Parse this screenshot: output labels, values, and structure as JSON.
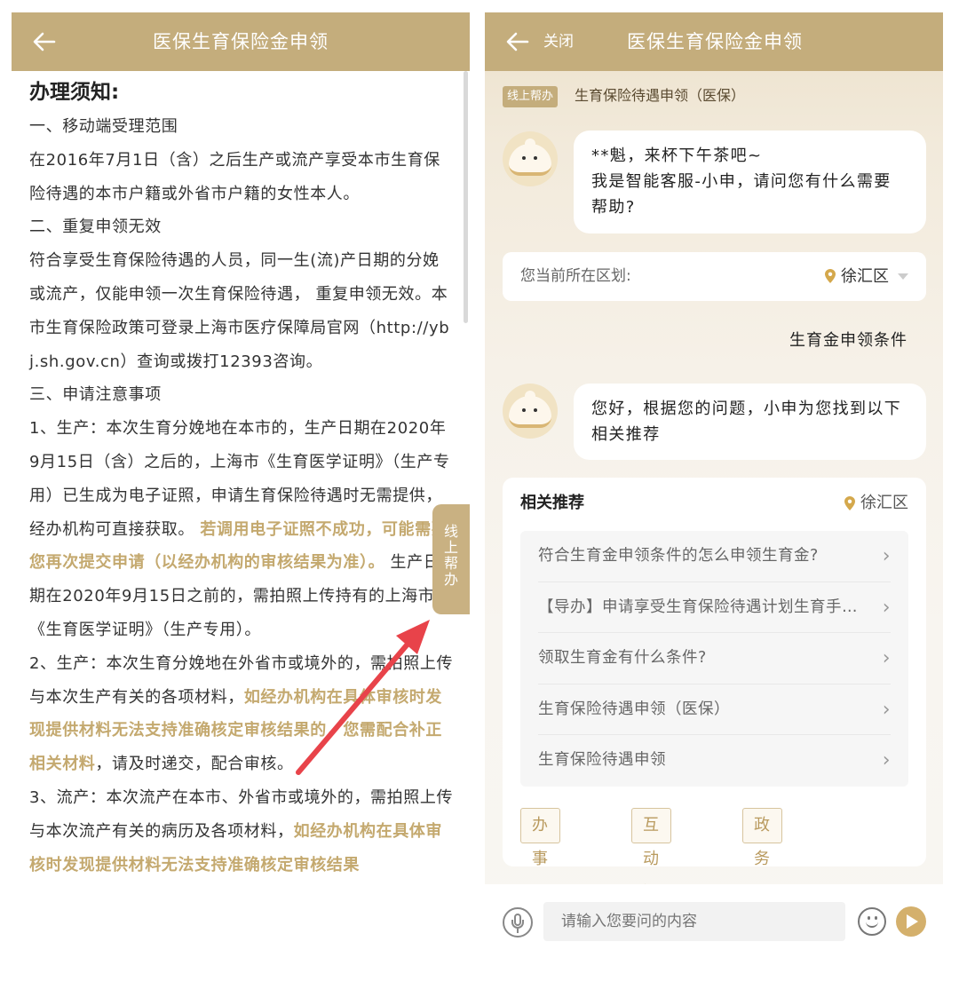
{
  "left": {
    "header_title": "医保生育保险金申领",
    "notice_title": "办理须知:",
    "notice": {
      "p1": "一、移动端受理范围",
      "p2": "在2016年7月1日（含）之后生产或流产享受本市生育保险待遇的本市户籍或外省市户籍的女性本人。",
      "p3": "二、重复申领无效",
      "p4": "符合享受生育保险待遇的人员，同一生(流)产日期的分娩或流产，仅能申领一次生育保险待遇， 重复申领无效。本市生育保险政策可登录上海市医疗保障局官网（http://ybj.sh.gov.cn）查询或拨打12393咨询。",
      "p5": "三、申请注意事项",
      "p6a": "1、生产：本次生育分娩地在本市的，生产日期在2020年9月15日（含）之后的，上海市《生育医学证明》（生产专用）已生成为电子证照，申请生育保险待遇时无需提供，经办机构可直接获取。",
      "p6b": "若调用电子证照不成功，可能需要您再次提交申请（以经办机构的审核结果为准）。",
      "p6c": "生产日期在2020年9月15日之前的，需拍照上传持有的上海市《生育医学证明》（生产专用）。",
      "p7a": "2、生产：本次生育分娩地在外省市或境外的，需拍照上传与本次生产有关的各项材料，",
      "p7b": "如经办机构在具体审核时发现提供材料无法支持准确核定审核结果的，您需配合补正相关材料",
      "p7c": "，请及时递交，配合审核。",
      "p8a": "3、流产：本次流产在本市、外省市或境外的，需拍照上传与本次流产有关的病历及各项材料，",
      "p8b": "如经办机构在具体审核时发现提供材料无法支持准确核定审核结果"
    },
    "float_help": [
      "线",
      "上",
      "帮",
      "办"
    ]
  },
  "right": {
    "close_label": "关闭",
    "header_title": "医保生育保险金申领",
    "tag": "线上帮办",
    "subtitle": "生育保险待遇申领（医保）",
    "greeting_line1": "**魁，来杯下午茶吧~",
    "greeting_line2": "我是智能客服-小申，请问您有什么需要帮助?",
    "region_label": "您当前所在区划:",
    "region_value": "徐汇区",
    "user_message": "生育金申领条件",
    "reply": "您好，根据您的问题，小申为您找到以下相关推荐",
    "rec_title": "相关推荐",
    "rec_location": "徐汇区",
    "rec_items": [
      "符合生育金申领条件的怎么申领生育金?",
      "【导办】申请享受生育保险待遇计划生育手术医疗费",
      "领取生育金有什么条件?",
      "生育保险待遇申领（医保）",
      "生育保险待遇申领"
    ],
    "buttons": [
      "办事服务",
      "互动问答",
      "政务百科"
    ],
    "input_placeholder": "请输入您要问的内容"
  },
  "colors": {
    "header": "#c4ad7c",
    "accent_text": "#c4a96f",
    "arrow": "#e8434a"
  }
}
